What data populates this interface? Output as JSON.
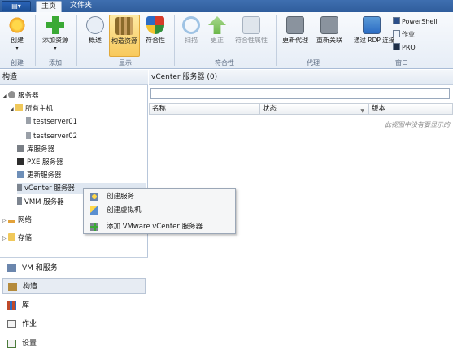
{
  "app_button": "▤▾",
  "tabs": [
    {
      "label": "主页",
      "active": true
    },
    {
      "label": "文件夹",
      "active": false
    }
  ],
  "ribbon": {
    "create": {
      "label": "创建",
      "group": "创建"
    },
    "add_resource": {
      "label": "添加资源",
      "group": "添加"
    },
    "show": {
      "overview": "概述",
      "fabric_resources": "构造资源",
      "compliance": "符合性",
      "group": "显示"
    },
    "compliance_group": {
      "scan": "扫描",
      "remediate": "更正",
      "properties": "符合性属性",
      "group": "符合性"
    },
    "agent": {
      "update_agent": "更新代理",
      "reassociate": "重新关联",
      "group": "代理"
    },
    "window": {
      "rdp": "通过 RDP 连接",
      "powershell": "PowerShell",
      "jobs": "作业",
      "pro": "PRO",
      "group": "窗口"
    }
  },
  "left_pane": {
    "title": "构造",
    "tree": {
      "servers": "服务器",
      "all_hosts": "所有主机",
      "host1": "testserver01",
      "host2": "testserver02",
      "library_servers": "库服务器",
      "pxe_servers": "PXE 服务器",
      "update_servers": "更新服务器",
      "vcenter_servers": "vCenter 服务器",
      "vmm_servers": "VMM 服务器",
      "networking": "网络",
      "storage": "存储"
    },
    "workspaces": [
      {
        "label": "VM 和服务"
      },
      {
        "label": "构造"
      },
      {
        "label": "库"
      },
      {
        "label": "作业"
      },
      {
        "label": "设置"
      }
    ]
  },
  "main_pane": {
    "title": "vCenter 服务器 (0)",
    "search_value": "",
    "columns": [
      "名称",
      "状态",
      "版本"
    ],
    "empty_message": "此视图中没有要显示的"
  },
  "context_menu": {
    "items": [
      {
        "label": "创建服务"
      },
      {
        "label": "创建虚拟机"
      },
      {
        "label": "添加 VMware vCenter 服务器"
      }
    ]
  },
  "colors": {
    "tab_bar": "#2f5d9c",
    "ribbon_highlight": "#f8c95c",
    "pane_border": "#b7c6da"
  }
}
